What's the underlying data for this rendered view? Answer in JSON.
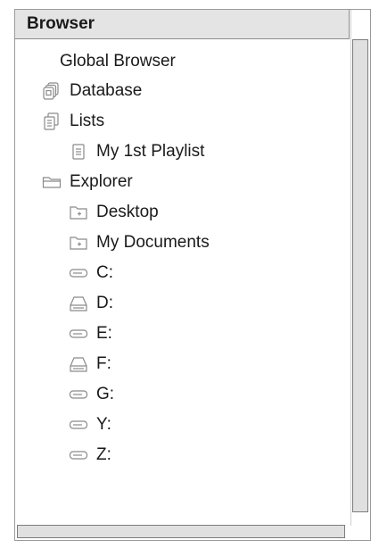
{
  "browser": {
    "title": "Browser",
    "items": [
      {
        "label": "Global Browser",
        "icon": "none"
      },
      {
        "label": "Database",
        "icon": "database-icon"
      },
      {
        "label": "Lists",
        "icon": "lists-icon"
      },
      {
        "label": "My 1st Playlist",
        "icon": "playlist-icon"
      },
      {
        "label": "Explorer",
        "icon": "explorer-folder-icon"
      },
      {
        "label": "Desktop",
        "icon": "folder-icon"
      },
      {
        "label": "My Documents",
        "icon": "folder-icon"
      },
      {
        "label": "C:",
        "icon": "hard-drive-icon"
      },
      {
        "label": "D:",
        "icon": "optical-drive-icon"
      },
      {
        "label": "E:",
        "icon": "hard-drive-icon"
      },
      {
        "label": "F:",
        "icon": "optical-drive-icon"
      },
      {
        "label": "G:",
        "icon": "hard-drive-icon"
      },
      {
        "label": "Y:",
        "icon": "hard-drive-icon"
      },
      {
        "label": "Z:",
        "icon": "hard-drive-icon"
      }
    ]
  }
}
